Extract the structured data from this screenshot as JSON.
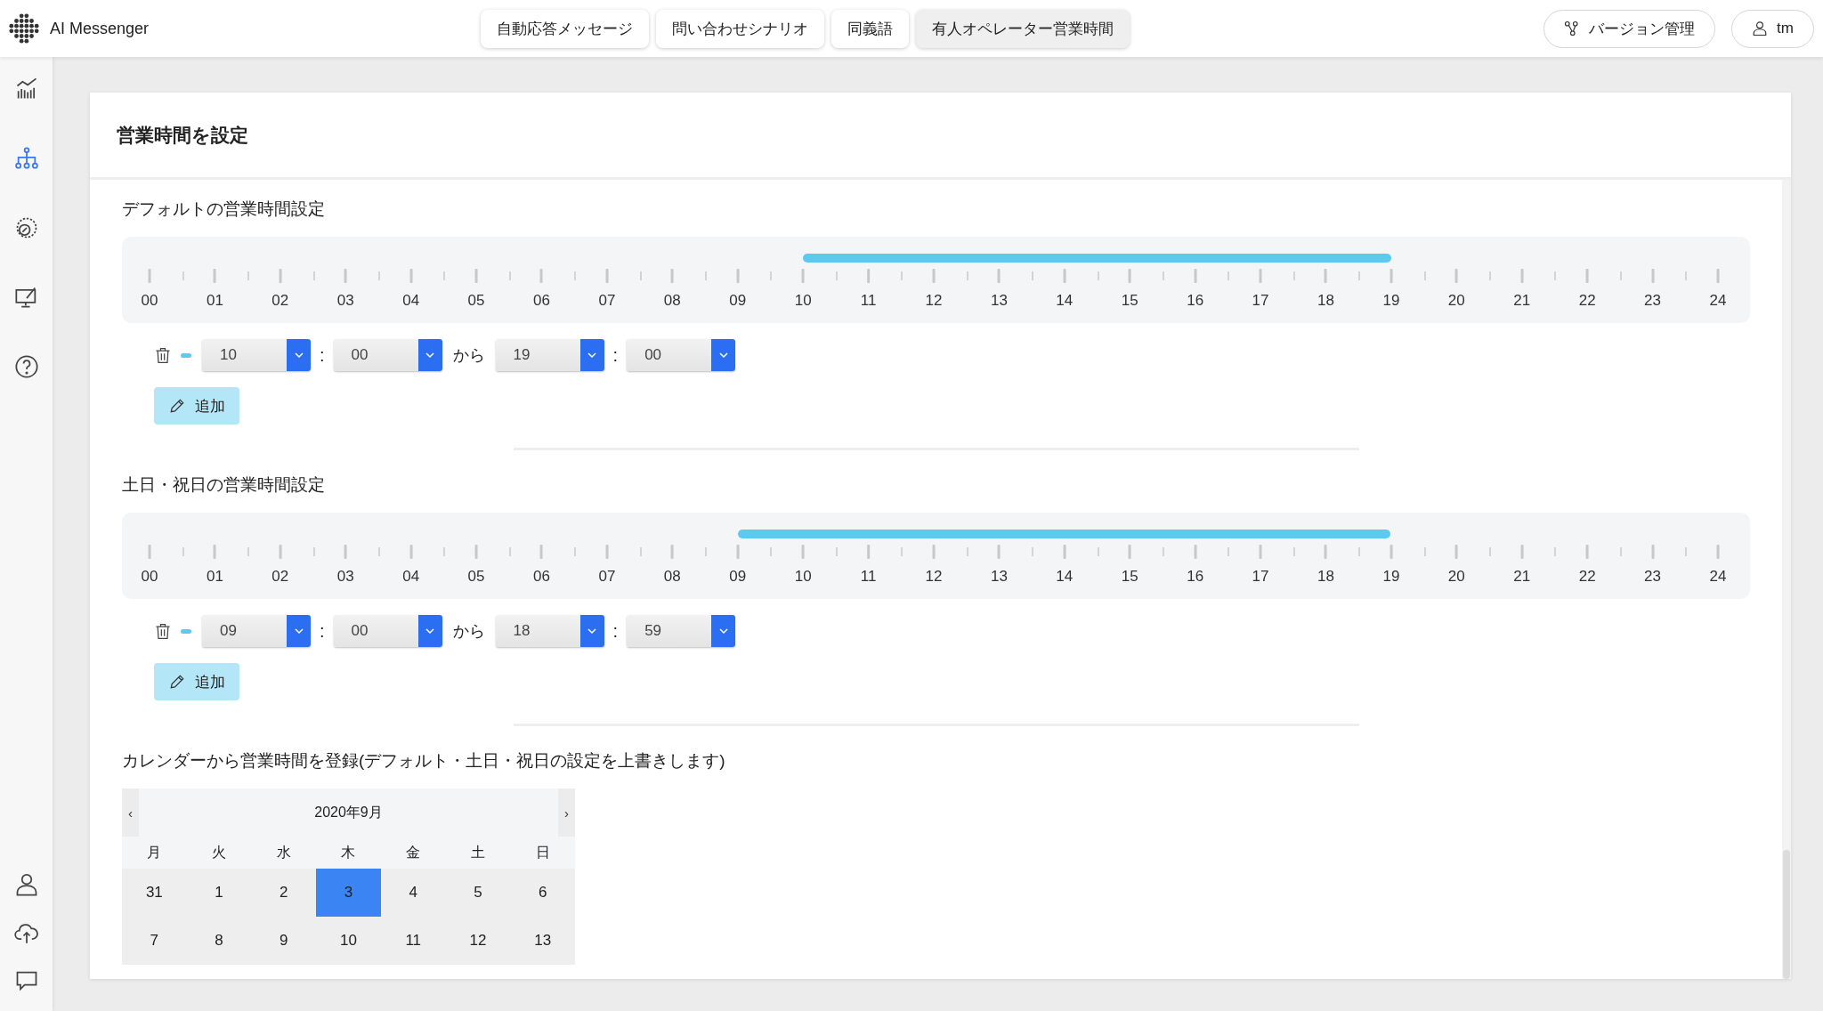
{
  "app": {
    "name": "AI Messenger"
  },
  "tabs": [
    {
      "label": "自動応答メッセージ",
      "selected": false
    },
    {
      "label": "問い合わせシナリオ",
      "selected": false
    },
    {
      "label": "同義語",
      "selected": false
    },
    {
      "label": "有人オペレーター営業時間",
      "selected": true
    }
  ],
  "header_buttons": [
    {
      "kind": "version",
      "label": "バージョン管理"
    },
    {
      "kind": "user",
      "label": "tm"
    }
  ],
  "sidebar": {
    "items": [
      {
        "kind": "chart",
        "selected": false
      },
      {
        "kind": "tree",
        "selected": true
      },
      {
        "kind": "brain",
        "selected": false
      },
      {
        "kind": "monitor",
        "selected": false
      },
      {
        "kind": "help",
        "selected": false
      }
    ],
    "bottom_items": [
      {
        "kind": "user"
      },
      {
        "kind": "upload"
      },
      {
        "kind": "chat"
      }
    ]
  },
  "page_title": "営業時間を設定",
  "sections": [
    {
      "title": "デフォルトの営業時間設定",
      "hours": [
        "00",
        "01",
        "02",
        "03",
        "04",
        "05",
        "06",
        "07",
        "08",
        "09",
        "10",
        "11",
        "12",
        "13",
        "14",
        "15",
        "16",
        "17",
        "18",
        "19",
        "20",
        "21",
        "22",
        "23",
        "24"
      ],
      "ranges": [
        {
          "start_hour": "10",
          "start_minute": "00",
          "separator": "から",
          "end_hour": "19",
          "end_minute": "00"
        }
      ],
      "colon": ":",
      "add_button": "追加"
    },
    {
      "title": "土日・祝日の営業時間設定",
      "hours": [
        "00",
        "01",
        "02",
        "03",
        "04",
        "05",
        "06",
        "07",
        "08",
        "09",
        "10",
        "11",
        "12",
        "13",
        "14",
        "15",
        "16",
        "17",
        "18",
        "19",
        "20",
        "21",
        "22",
        "23",
        "24"
      ],
      "ranges": [
        {
          "start_hour": "09",
          "start_minute": "00",
          "separator": "から",
          "end_hour": "18",
          "end_minute": "59"
        }
      ],
      "colon": ":",
      "add_button": "追加"
    }
  ],
  "calendar": {
    "title": "カレンダーから営業時間を登録(デフォルト・土日・祝日の設定を上書きします)",
    "prev": "‹",
    "next": "›",
    "month": "2020年9月",
    "weekdays": [
      "月",
      "火",
      "水",
      "木",
      "金",
      "土",
      "日"
    ],
    "weeks": [
      [
        {
          "day": "31",
          "selected": false
        },
        {
          "day": "1",
          "selected": false
        },
        {
          "day": "2",
          "selected": false
        },
        {
          "day": "3",
          "selected": true
        },
        {
          "day": "4",
          "selected": false
        },
        {
          "day": "5",
          "selected": false
        },
        {
          "day": "6",
          "selected": false
        }
      ],
      [
        {
          "day": "7",
          "selected": false
        },
        {
          "day": "8",
          "selected": false
        },
        {
          "day": "9",
          "selected": false
        },
        {
          "day": "10",
          "selected": false
        },
        {
          "day": "11",
          "selected": false
        },
        {
          "day": "12",
          "selected": false
        },
        {
          "day": "13",
          "selected": false
        }
      ]
    ]
  }
}
